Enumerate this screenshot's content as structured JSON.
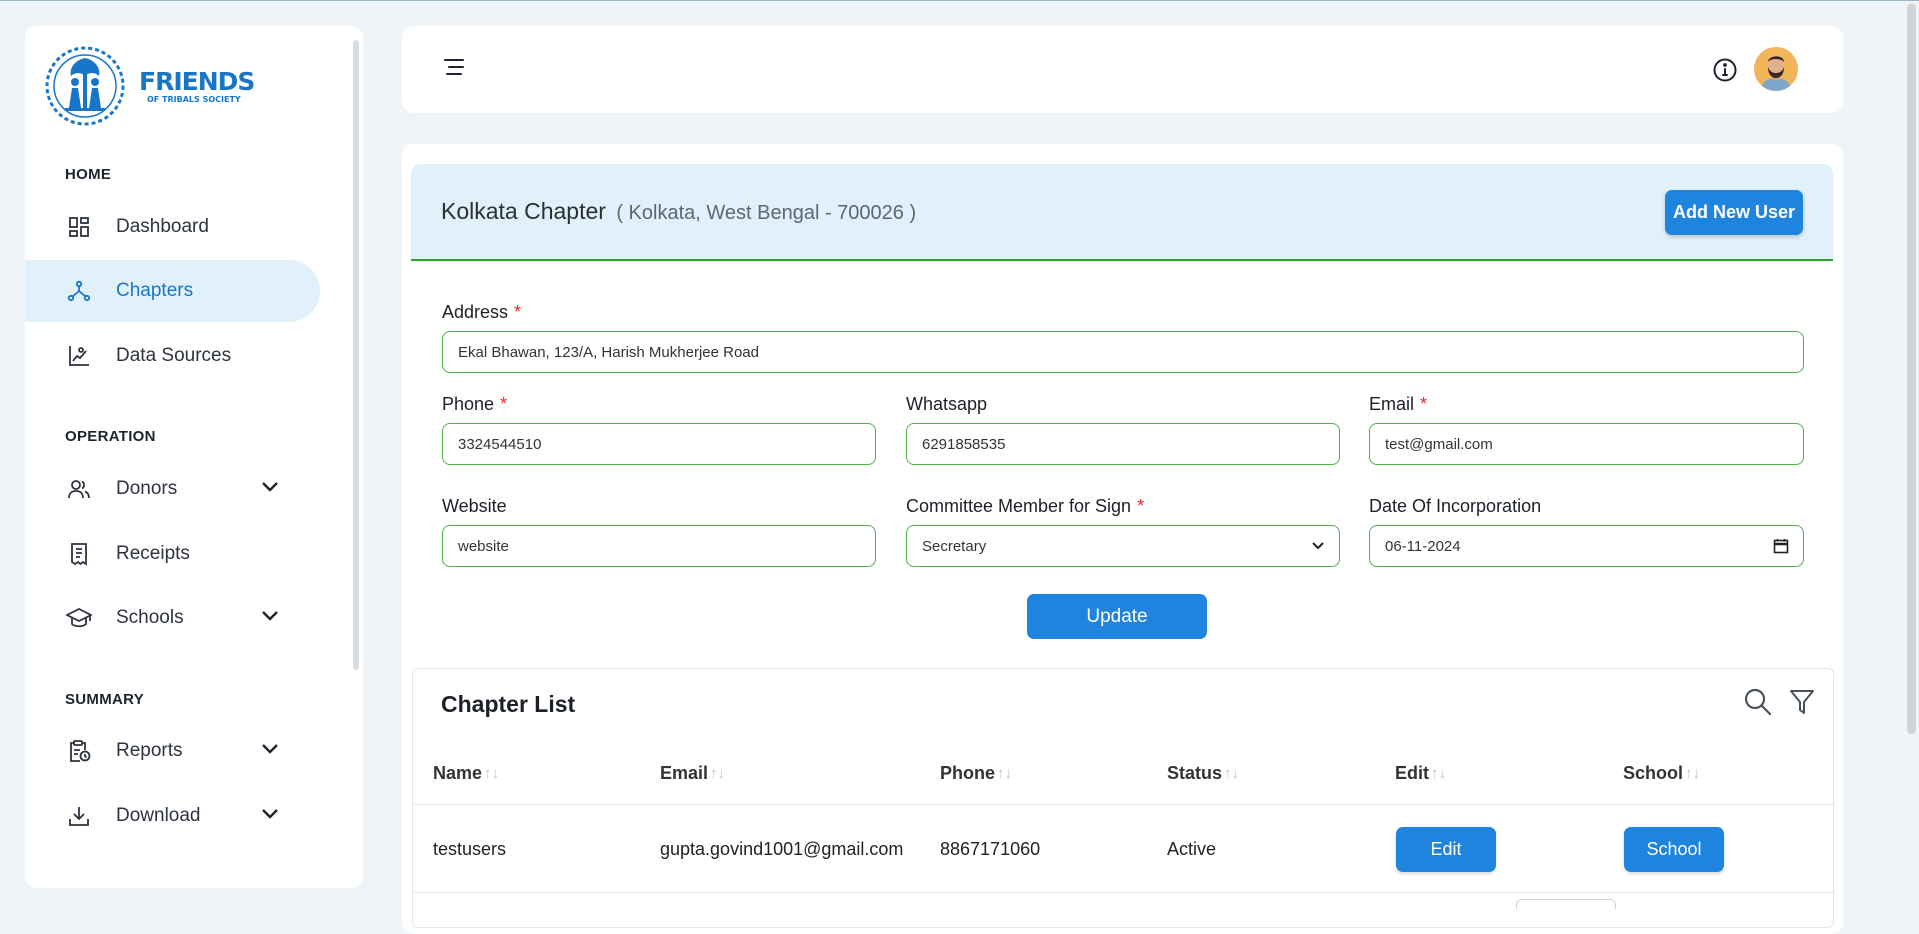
{
  "brand": {
    "name": "FRIENDS",
    "tagline": "OF TRIBALS SOCIETY",
    "color": "#1776c8"
  },
  "sidebar": {
    "sections": {
      "home": "HOME",
      "operation": "OPERATION",
      "summary": "SUMMARY"
    },
    "items": [
      {
        "label": "Dashboard",
        "icon": "dashboard-icon"
      },
      {
        "label": "Chapters",
        "icon": "chapters-icon",
        "active": true
      },
      {
        "label": "Data Sources",
        "icon": "data-sources-icon"
      },
      {
        "label": "Donors",
        "icon": "donors-icon",
        "expandable": true
      },
      {
        "label": "Receipts",
        "icon": "receipt-icon"
      },
      {
        "label": "Schools",
        "icon": "school-icon",
        "expandable": true
      },
      {
        "label": "Reports",
        "icon": "reports-icon",
        "expandable": true
      },
      {
        "label": "Download",
        "icon": "download-icon",
        "expandable": true
      }
    ]
  },
  "header": {
    "menu_icon": "menu-icon",
    "info_icon": "info-icon",
    "avatar": "user-avatar"
  },
  "chapter": {
    "name": "Kolkata Chapter",
    "location": "( Kolkata, West Bengal - 700026 )",
    "add_user_label": "Add New User",
    "form": {
      "address_label": "Address",
      "address_value": "Ekal Bhawan, 123/A, Harish Mukherjee Road",
      "phone_label": "Phone",
      "phone_value": "3324544510",
      "whatsapp_label": "Whatsapp",
      "whatsapp_value": "6291858535",
      "email_label": "Email",
      "email_value": "test@gmail.com",
      "website_label": "Website",
      "website_value": "website",
      "committee_label": "Committee Member for Sign",
      "committee_value": "Secretary",
      "incorporation_label": "Date Of Incorporation",
      "incorporation_value": "06-11-2024",
      "required_mark": "*"
    },
    "update_label": "Update"
  },
  "chapter_list": {
    "title": "Chapter List",
    "columns": [
      "Name",
      "Email",
      "Phone",
      "Status",
      "Edit",
      "School"
    ],
    "sort_glyph": "↑↓",
    "rows": [
      {
        "name": "testusers",
        "email": "gupta.govind1001@gmail.com",
        "phone": "8867171060",
        "status": "Active",
        "edit_label": "Edit",
        "school_label": "School"
      }
    ]
  },
  "colors": {
    "primary": "#1f84dd",
    "active_bg": "#e1f1fa",
    "field_border": "#4fb04f",
    "required": "#e22"
  }
}
